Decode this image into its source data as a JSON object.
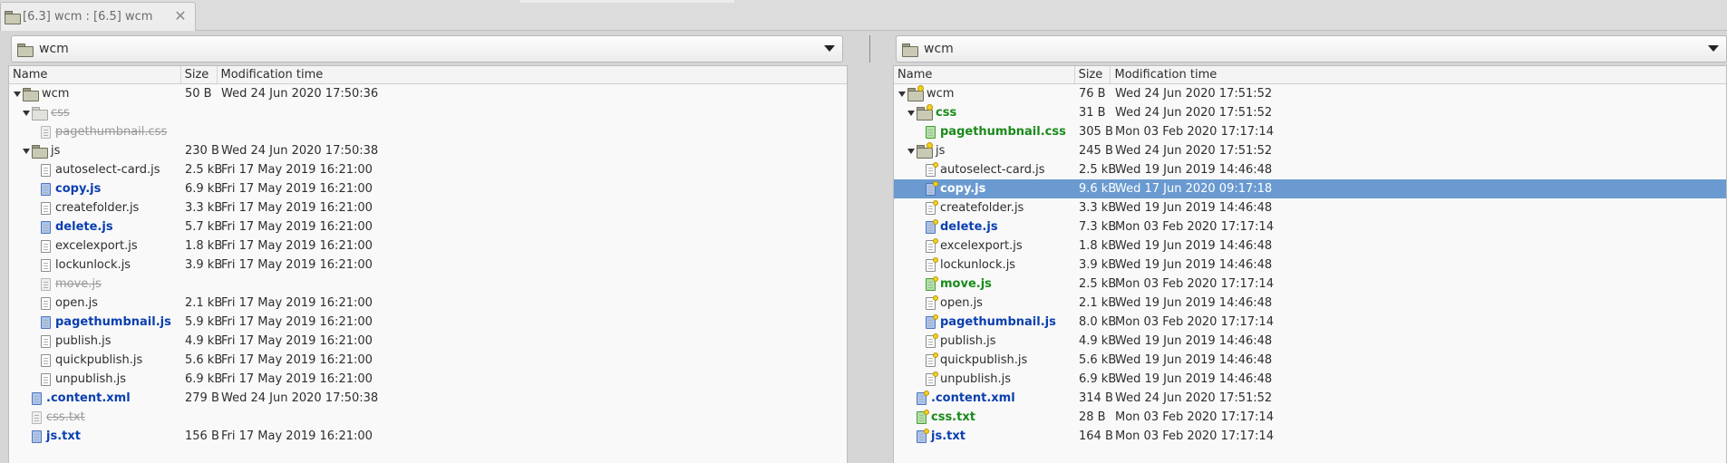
{
  "tab": {
    "label": "[6.3] wcm : [6.5] wcm",
    "close": "✕"
  },
  "left": {
    "path": "wcm",
    "columns": {
      "name": "Name",
      "size": "Size",
      "mtime": "Modification time"
    },
    "rows": [
      {
        "level": 0,
        "expander": "open",
        "icon": "folder",
        "name": "wcm",
        "style": "normal",
        "size": "50 B",
        "mtime": "Wed 24 Jun 2020 17:50:36"
      },
      {
        "level": 1,
        "expander": "open",
        "icon": "folder-gray",
        "name": "css",
        "style": "gone",
        "size": "",
        "mtime": ""
      },
      {
        "level": 2,
        "expander": "none",
        "icon": "file-gray",
        "name": "pagethumbnail.css",
        "style": "gone",
        "size": "",
        "mtime": ""
      },
      {
        "level": 1,
        "expander": "open",
        "icon": "folder",
        "name": "js",
        "style": "normal",
        "size": "230 B",
        "mtime": "Wed 24 Jun 2020 17:50:38"
      },
      {
        "level": 2,
        "expander": "none",
        "icon": "file",
        "name": "autoselect-card.js",
        "style": "normal",
        "size": "2.5 kB",
        "mtime": "Fri 17 May 2019 16:21:00"
      },
      {
        "level": 2,
        "expander": "none",
        "icon": "file-blue",
        "name": "copy.js",
        "style": "blue",
        "size": "6.9 kB",
        "mtime": "Fri 17 May 2019 16:21:00"
      },
      {
        "level": 2,
        "expander": "none",
        "icon": "file",
        "name": "createfolder.js",
        "style": "normal",
        "size": "3.3 kB",
        "mtime": "Fri 17 May 2019 16:21:00"
      },
      {
        "level": 2,
        "expander": "none",
        "icon": "file-blue",
        "name": "delete.js",
        "style": "blue",
        "size": "5.7 kB",
        "mtime": "Fri 17 May 2019 16:21:00"
      },
      {
        "level": 2,
        "expander": "none",
        "icon": "file",
        "name": "excelexport.js",
        "style": "normal",
        "size": "1.8 kB",
        "mtime": "Fri 17 May 2019 16:21:00"
      },
      {
        "level": 2,
        "expander": "none",
        "icon": "file",
        "name": "lockunlock.js",
        "style": "normal",
        "size": "3.9 kB",
        "mtime": "Fri 17 May 2019 16:21:00"
      },
      {
        "level": 2,
        "expander": "none",
        "icon": "file-gray",
        "name": "move.js",
        "style": "gone",
        "size": "",
        "mtime": ""
      },
      {
        "level": 2,
        "expander": "none",
        "icon": "file",
        "name": "open.js",
        "style": "normal",
        "size": "2.1 kB",
        "mtime": "Fri 17 May 2019 16:21:00"
      },
      {
        "level": 2,
        "expander": "none",
        "icon": "file-blue",
        "name": "pagethumbnail.js",
        "style": "blue",
        "size": "5.9 kB",
        "mtime": "Fri 17 May 2019 16:21:00"
      },
      {
        "level": 2,
        "expander": "none",
        "icon": "file",
        "name": "publish.js",
        "style": "normal",
        "size": "4.9 kB",
        "mtime": "Fri 17 May 2019 16:21:00"
      },
      {
        "level": 2,
        "expander": "none",
        "icon": "file",
        "name": "quickpublish.js",
        "style": "normal",
        "size": "5.6 kB",
        "mtime": "Fri 17 May 2019 16:21:00"
      },
      {
        "level": 2,
        "expander": "none",
        "icon": "file",
        "name": "unpublish.js",
        "style": "normal",
        "size": "6.9 kB",
        "mtime": "Fri 17 May 2019 16:21:00"
      },
      {
        "level": 1,
        "expander": "none",
        "icon": "file-blue",
        "name": ".content.xml",
        "style": "blue",
        "size": "279 B",
        "mtime": "Wed 24 Jun 2020 17:50:38"
      },
      {
        "level": 1,
        "expander": "none",
        "icon": "file-gray",
        "name": "css.txt",
        "style": "gone",
        "size": "",
        "mtime": ""
      },
      {
        "level": 1,
        "expander": "none",
        "icon": "file-blue",
        "name": "js.txt",
        "style": "blue",
        "size": "156 B",
        "mtime": "Fri 17 May 2019 16:21:00"
      }
    ]
  },
  "right": {
    "path": "wcm",
    "columns": {
      "name": "Name",
      "size": "Size",
      "mtime": "Modification time"
    },
    "rows": [
      {
        "level": 0,
        "expander": "open",
        "icon": "folder-star",
        "name": "wcm",
        "style": "normal",
        "size": "76 B",
        "mtime": "Wed 24 Jun 2020 17:51:52"
      },
      {
        "level": 1,
        "expander": "open",
        "icon": "folder-star",
        "name": "css",
        "style": "green",
        "size": "31 B",
        "mtime": "Wed 24 Jun 2020 17:51:52"
      },
      {
        "level": 2,
        "expander": "none",
        "icon": "file-green",
        "name": "pagethumbnail.css",
        "style": "green",
        "size": "305 B",
        "mtime": "Mon 03 Feb 2020 17:17:14"
      },
      {
        "level": 1,
        "expander": "open",
        "icon": "folder-star",
        "name": "js",
        "style": "normal",
        "size": "245 B",
        "mtime": "Wed 24 Jun 2020 17:51:52"
      },
      {
        "level": 2,
        "expander": "none",
        "icon": "file-star",
        "name": "autoselect-card.js",
        "style": "normal",
        "size": "2.5 kB",
        "mtime": "Wed 19 Jun 2019 14:46:48"
      },
      {
        "level": 2,
        "expander": "none",
        "icon": "file-blue-star",
        "name": "copy.js",
        "style": "blue",
        "size": "9.6 kB",
        "mtime": "Wed 17 Jun 2020 09:17:18",
        "selected": true
      },
      {
        "level": 2,
        "expander": "none",
        "icon": "file-star",
        "name": "createfolder.js",
        "style": "normal",
        "size": "3.3 kB",
        "mtime": "Wed 19 Jun 2019 14:46:48"
      },
      {
        "level": 2,
        "expander": "none",
        "icon": "file-blue-star",
        "name": "delete.js",
        "style": "blue",
        "size": "7.3 kB",
        "mtime": "Mon 03 Feb 2020 17:17:14"
      },
      {
        "level": 2,
        "expander": "none",
        "icon": "file-star",
        "name": "excelexport.js",
        "style": "normal",
        "size": "1.8 kB",
        "mtime": "Wed 19 Jun 2019 14:46:48"
      },
      {
        "level": 2,
        "expander": "none",
        "icon": "file-star",
        "name": "lockunlock.js",
        "style": "normal",
        "size": "3.9 kB",
        "mtime": "Wed 19 Jun 2019 14:46:48"
      },
      {
        "level": 2,
        "expander": "none",
        "icon": "file-green-star",
        "name": "move.js",
        "style": "green",
        "size": "2.5 kB",
        "mtime": "Mon 03 Feb 2020 17:17:14"
      },
      {
        "level": 2,
        "expander": "none",
        "icon": "file-star",
        "name": "open.js",
        "style": "normal",
        "size": "2.1 kB",
        "mtime": "Wed 19 Jun 2019 14:46:48"
      },
      {
        "level": 2,
        "expander": "none",
        "icon": "file-blue-star",
        "name": "pagethumbnail.js",
        "style": "blue",
        "size": "8.0 kB",
        "mtime": "Mon 03 Feb 2020 17:17:14"
      },
      {
        "level": 2,
        "expander": "none",
        "icon": "file-star",
        "name": "publish.js",
        "style": "normal",
        "size": "4.9 kB",
        "mtime": "Wed 19 Jun 2019 14:46:48"
      },
      {
        "level": 2,
        "expander": "none",
        "icon": "file-star",
        "name": "quickpublish.js",
        "style": "normal",
        "size": "5.6 kB",
        "mtime": "Wed 19 Jun 2019 14:46:48"
      },
      {
        "level": 2,
        "expander": "none",
        "icon": "file-star",
        "name": "unpublish.js",
        "style": "normal",
        "size": "6.9 kB",
        "mtime": "Wed 19 Jun 2019 14:46:48"
      },
      {
        "level": 1,
        "expander": "none",
        "icon": "file-blue-star",
        "name": ".content.xml",
        "style": "blue",
        "size": "314 B",
        "mtime": "Wed 24 Jun 2020 17:51:52"
      },
      {
        "level": 1,
        "expander": "none",
        "icon": "file-green-star",
        "name": "css.txt",
        "style": "green",
        "size": "28 B",
        "mtime": "Mon 03 Feb 2020 17:17:14"
      },
      {
        "level": 1,
        "expander": "none",
        "icon": "file-blue-star",
        "name": "js.txt",
        "style": "blue",
        "size": "164 B",
        "mtime": "Mon 03 Feb 2020 17:17:14"
      }
    ]
  }
}
